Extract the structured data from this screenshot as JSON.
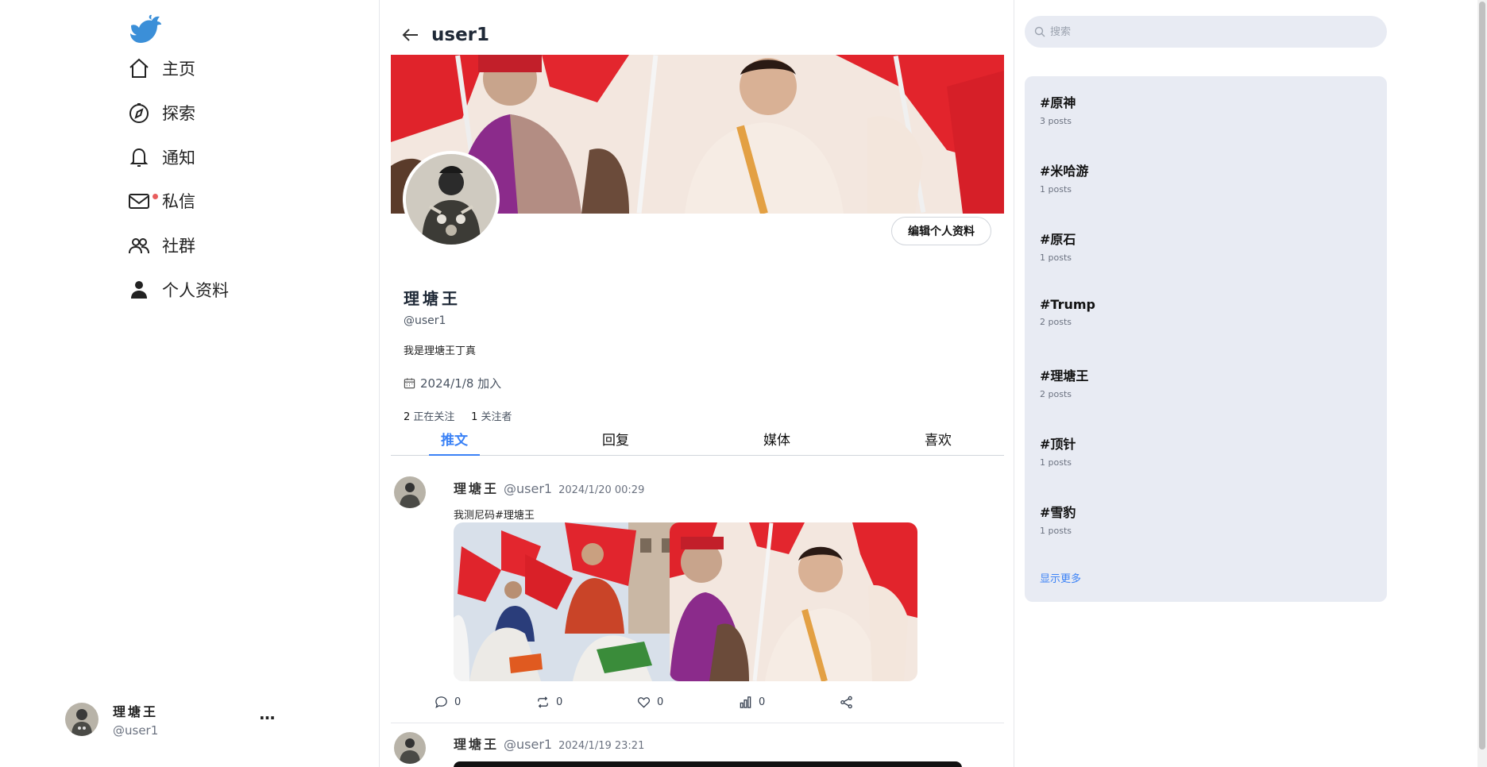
{
  "nav": {
    "items": [
      {
        "label": "主页",
        "icon": "home-icon"
      },
      {
        "label": "探索",
        "icon": "compass-icon"
      },
      {
        "label": "通知",
        "icon": "bell-icon"
      },
      {
        "label": "私信",
        "icon": "mail-icon"
      },
      {
        "label": "社群",
        "icon": "community-icon"
      },
      {
        "label": "个人资料",
        "icon": "person-icon"
      }
    ]
  },
  "account": {
    "name": "理塘王",
    "handle": "@user1",
    "more": "···"
  },
  "header": {
    "title": "user1"
  },
  "profile": {
    "name": "理塘王",
    "handle": "@user1",
    "bio": "我是理塘王丁真",
    "joined": "2024/1/8 加入",
    "following_count": "2",
    "following_label": "正在关注",
    "followers_count": "1",
    "followers_label": "关注者",
    "edit_label": "编辑个人资料"
  },
  "tabs": [
    "推文",
    "回复",
    "媒体",
    "喜欢"
  ],
  "posts": [
    {
      "name": "理塘王",
      "handle": "@user1",
      "time": "2024/1/20 00:29",
      "text": "我测尼码#理塘王",
      "replies": "0",
      "retweets": "0",
      "likes": "0",
      "views": "0"
    },
    {
      "name": "理塘王",
      "handle": "@user1",
      "time": "2024/1/19 23:21"
    }
  ],
  "search": {
    "placeholder": "搜索"
  },
  "trends": [
    {
      "tag": "#原神",
      "count": "3 posts"
    },
    {
      "tag": "#米哈游",
      "count": "1 posts"
    },
    {
      "tag": "#原石",
      "count": "1 posts"
    },
    {
      "tag": "#Trump",
      "count": "2 posts"
    },
    {
      "tag": "#理塘王",
      "count": "2 posts"
    },
    {
      "tag": "#顶针",
      "count": "1 posts"
    },
    {
      "tag": "#雪豹",
      "count": "1 posts"
    }
  ],
  "show_more": "显示更多",
  "colors": {
    "accent": "#3b82f6",
    "logo": "#3b8fd8",
    "panel": "#e8ebf3",
    "notify_dot": "#e85d5d"
  }
}
